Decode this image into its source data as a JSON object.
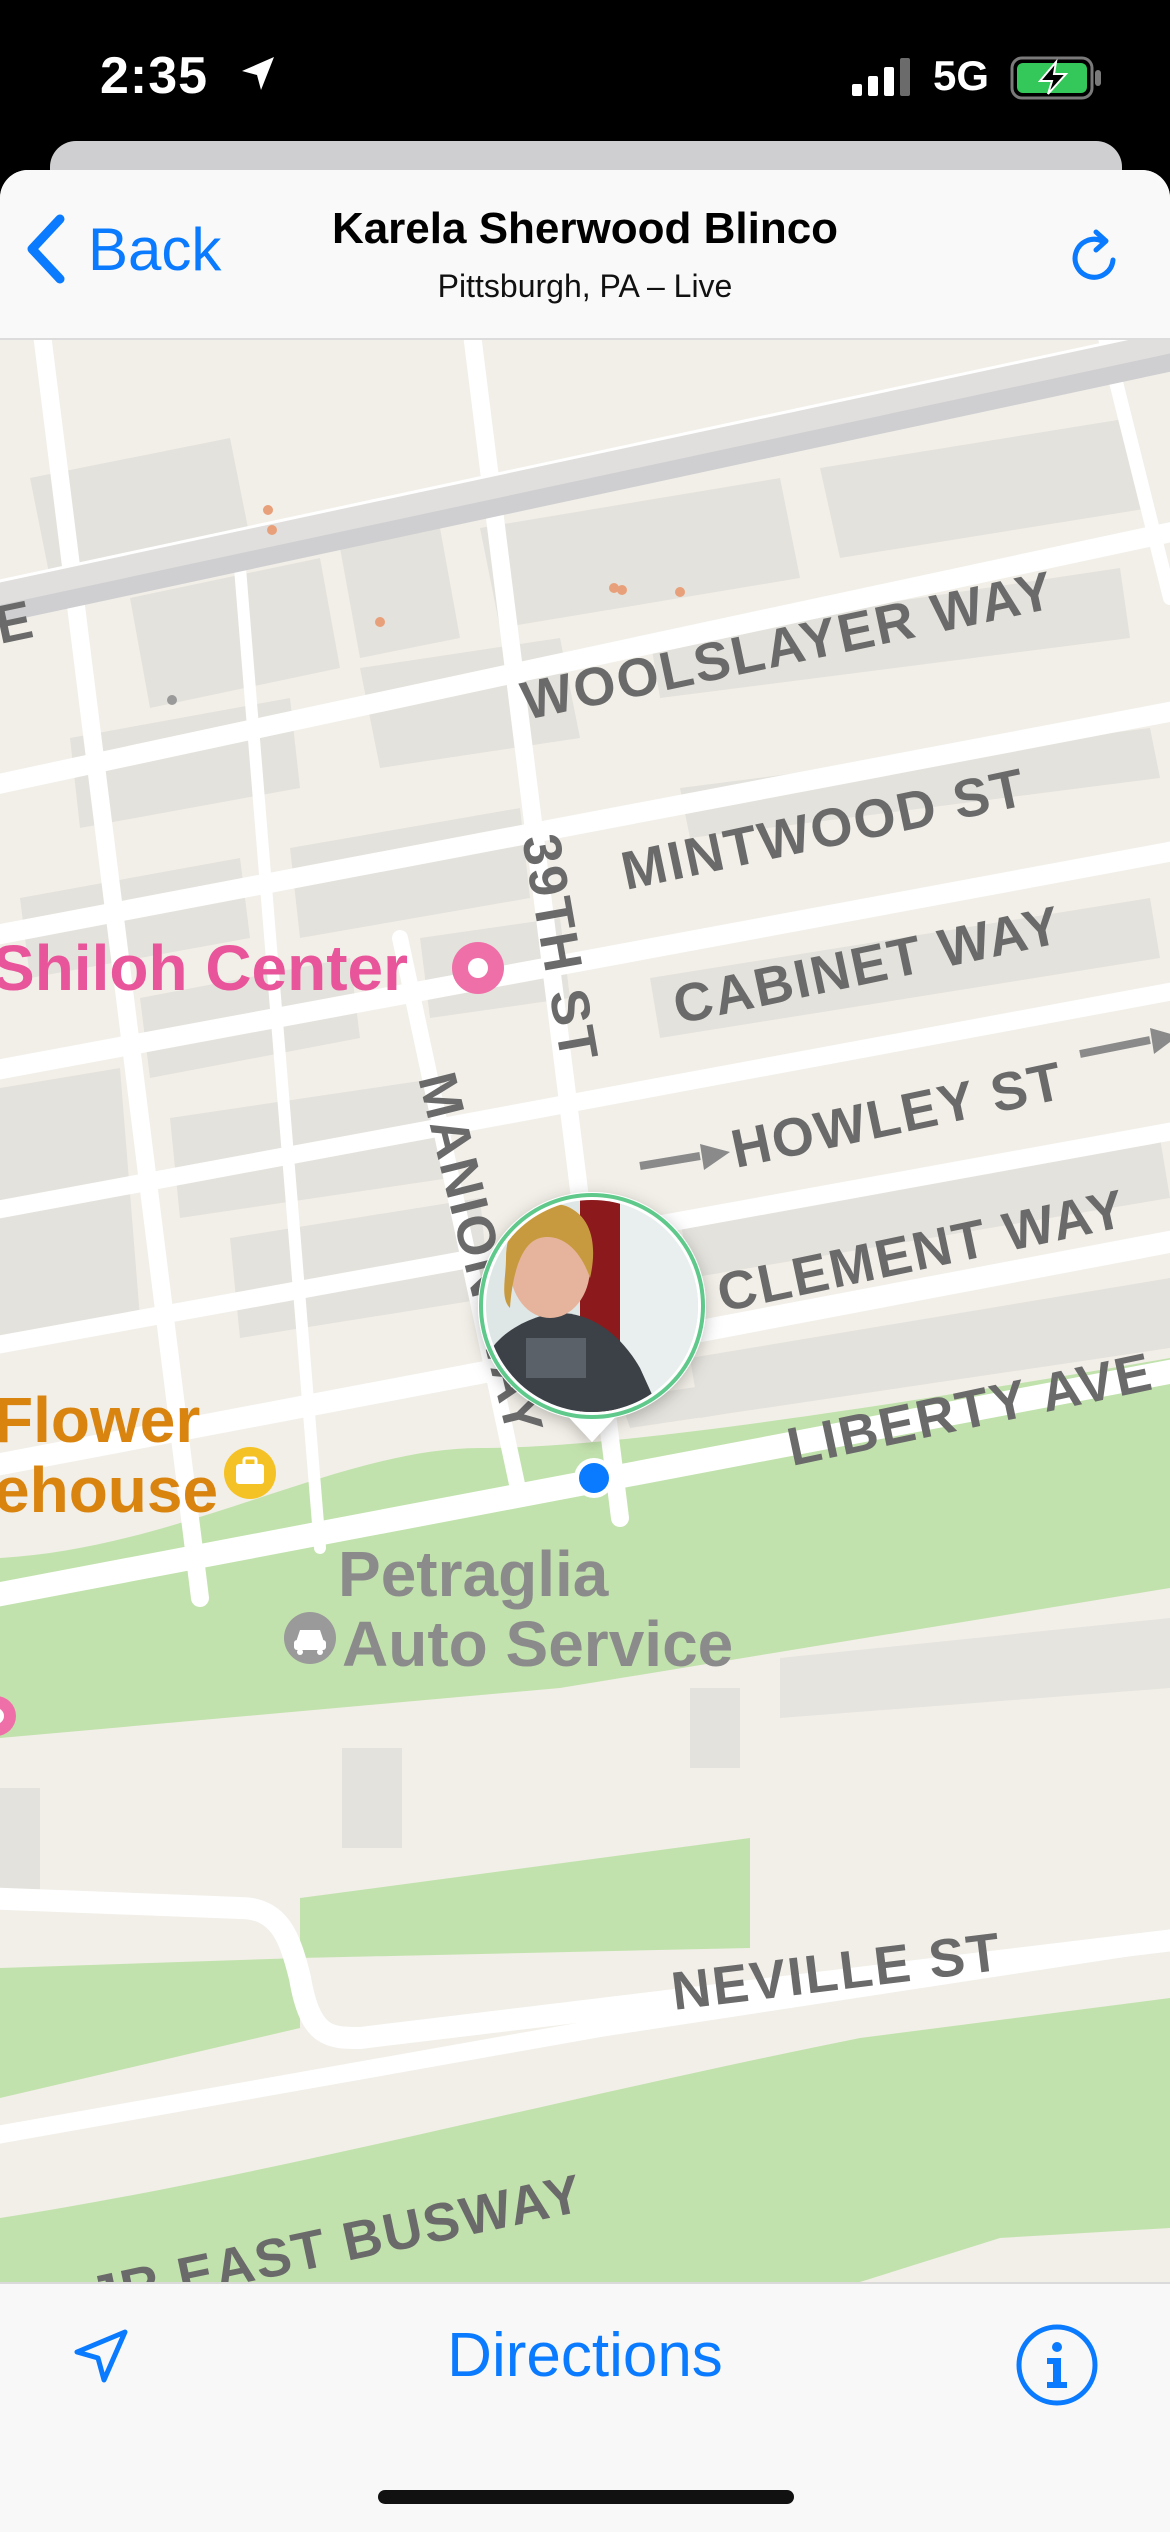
{
  "status_bar": {
    "time": "2:35",
    "network": "5G",
    "icons": [
      "location-arrow-icon",
      "signal-bars-icon",
      "battery-charging-icon"
    ]
  },
  "nav": {
    "back_label": "Back",
    "title": "Karela Sherwood Blinco",
    "subtitle": "Pittsburgh, PA – Live",
    "refresh_icon": "refresh-icon"
  },
  "map": {
    "streets": {
      "woolslayer": "WOOLSLAYER WAY",
      "mintwood": "MINTWOOD ST",
      "st39": "39TH ST",
      "cabinet": "CABINET WAY",
      "howley": "HOWLEY ST",
      "manion": "MANION WAY",
      "clement": "CLEMENT WAY",
      "liberty": "LIBERTY AVE",
      "neville": "NEVILLE ST",
      "busway": "NG JR EAST BUSWAY",
      "edge_letter": "E"
    },
    "pois": {
      "shiloh": "Shiloh Center",
      "flower_1": "Flower",
      "flower_2": "ehouse",
      "petraglia_1": "Petraglia",
      "petraglia_2": "Auto Service"
    },
    "colors": {
      "land": "#f2efe8",
      "park": "#c2e2ad",
      "road": "#ffffff",
      "block": "#e5e3df",
      "poi_pink": "#e8559a",
      "poi_orange": "#d9840f",
      "accent_blue": "#0a7aff",
      "avatar_ring": "#5fc98b"
    }
  },
  "toolbar": {
    "directions_label": "Directions",
    "location_icon": "location-arrow-icon",
    "info_icon": "info-icon"
  }
}
